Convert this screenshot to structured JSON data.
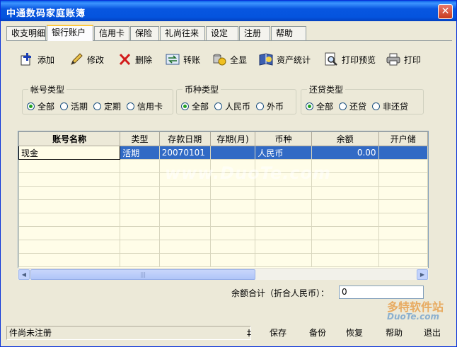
{
  "window": {
    "title": "中通数码家庭账簿",
    "close_glyph": "✕"
  },
  "tabs": [
    {
      "label": "收支明细",
      "active": false
    },
    {
      "label": "银行账户",
      "active": true
    },
    {
      "label": "信用卡",
      "active": false
    },
    {
      "label": "保险",
      "active": false
    },
    {
      "label": "礼尚往来",
      "active": false
    },
    {
      "label": "设定",
      "active": false
    },
    {
      "label": "注册",
      "active": false
    },
    {
      "label": "帮助",
      "active": false
    }
  ],
  "toolbar": {
    "add": "添加",
    "edit": "修改",
    "delete": "删除",
    "transfer": "转账",
    "show_all": "全显",
    "asset_stats": "资产统计",
    "print_preview": "打印预览",
    "print": "打印"
  },
  "filters": {
    "account_type": {
      "label": "帐号类型",
      "options": [
        "全部",
        "活期",
        "定期",
        "信用卡"
      ],
      "selected": "全部"
    },
    "currency_type": {
      "label": "币种类型",
      "options": [
        "全部",
        "人民币",
        "外币"
      ],
      "selected": "全部"
    },
    "repay_type": {
      "label": "还贷类型",
      "options": [
        "全部",
        "还贷",
        "非还贷"
      ],
      "selected": "全部"
    }
  },
  "table": {
    "headers": [
      "账号名称",
      "类型",
      "存款日期",
      "存期(月)",
      "币种",
      "余额",
      "开户储"
    ],
    "rows": [
      [
        "现金",
        "活期",
        "20070101",
        "",
        "人民币",
        "0.00",
        ""
      ]
    ]
  },
  "total": {
    "label": "余额合计（折合人民币）：",
    "value": "0"
  },
  "status": {
    "text": "件尚未注册",
    "marker": "‡",
    "buttons": [
      "保存",
      "备份",
      "恢复",
      "帮助",
      "退出"
    ]
  },
  "watermark": {
    "main": "www.DuoTe.com",
    "brand": "多特软件站",
    "brand_url": "DuoTe.com"
  },
  "colors": {
    "title_bar": "#0454de",
    "selection": "#316ac5",
    "grid_bg": "#fffde8"
  }
}
